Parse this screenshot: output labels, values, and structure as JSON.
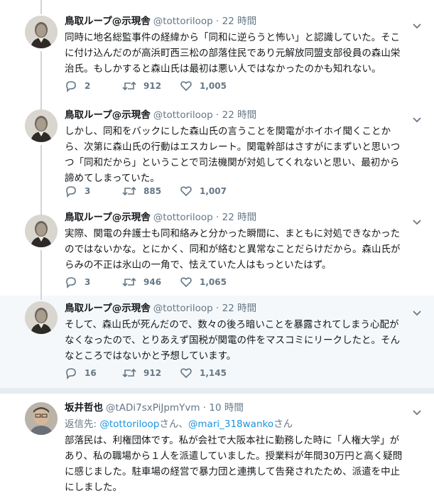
{
  "tweets": [
    {
      "name": "鳥取ループ@示現舎",
      "handle": "@tottoriloop",
      "dot": "·",
      "time": "22 時間",
      "lines": [
        "同時に地名総監事件の経緯から「同和に逆らうと怖い」と認識していた。そこ",
        "に付け込んだのが高浜町西三松の部落住民であり元解放同盟支部役員の森山栄",
        "治氏。もしかすると森山氏は最初は悪い人ではなかったのかも知れない。"
      ],
      "replies": "2",
      "retweets": "912",
      "likes": "1,005"
    },
    {
      "name": "鳥取ループ@示現舎",
      "handle": "@tottoriloop",
      "dot": "·",
      "time": "22 時間",
      "lines": [
        "しかし、同和をバックにした森山氏の言うことを関電がホイホイ聞くことか",
        "ら、次第に森山氏の行動はエスカレート。関電幹部はさすがにまずいと思いつ",
        "つ「同和だから」ということで司法機関が対処してくれないと思い、最初から",
        "諦めてしまっていた。"
      ],
      "replies": "3",
      "retweets": "885",
      "likes": "1,007"
    },
    {
      "name": "鳥取ループ@示現舎",
      "handle": "@tottoriloop",
      "dot": "·",
      "time": "22 時間",
      "lines": [
        "実際、関電の弁護士も同和絡みと分かった瞬間に、まともに対処できなかった",
        "のではないかな。とにかく、同和が絡むと異常なことだらけだから。森山氏が",
        "らみの不正は氷山の一角で、怯えていた人はもっといたはず。"
      ],
      "replies": "3",
      "retweets": "946",
      "likes": "1,065"
    },
    {
      "name": "鳥取ループ@示現舎",
      "handle": "@tottoriloop",
      "dot": "·",
      "time": "22 時間",
      "lines": [
        "そして、森山氏が死んだので、数々の後ろ暗いことを暴露されてしまう心配が",
        "なくなったので、とりあえず国税が関電の件をマスコミにリークしたと。そん",
        "なところではないかと予想しています。"
      ],
      "replies": "16",
      "retweets": "912",
      "likes": "1,145"
    }
  ],
  "reply_tweet": {
    "name": "坂井哲也",
    "handle": "@tADi7sxPiJpmYvm",
    "dot": "·",
    "time": "10 時間",
    "reply_prefix": "返信先: ",
    "mention1": "@tottoriloop",
    "suffix1": "さん、",
    "mention2": "@mari_318wanko",
    "suffix2": "さん",
    "lines": [
      "部落民は、利権団体です。私が会社で大阪本社に勤務した時に「人権大学」が",
      "あり、私の職場から１人を派遣していました。授業料が年間30万円と高く疑問",
      "に感じました。駐車場の経営で暴力団と連携して告発されたため、派遣を中止",
      "にしました。"
    ]
  },
  "colors": {
    "text": "#14171a",
    "muted": "#657786",
    "link": "#1b95e0",
    "highlight_bg": "#f5f8fa",
    "divider": "#e6ecf0"
  },
  "icons": [
    "reply-icon",
    "retweet-icon",
    "like-icon",
    "caret-down-icon"
  ]
}
